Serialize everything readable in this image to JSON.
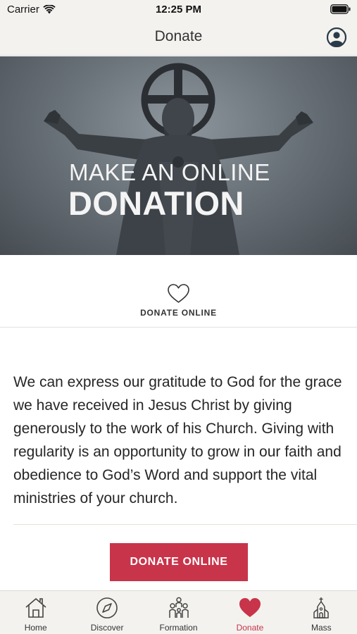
{
  "status_bar": {
    "carrier": "Carrier",
    "time": "12:25 PM"
  },
  "nav": {
    "title": "Donate",
    "profile_icon": "profile-icon"
  },
  "hero": {
    "line1": "MAKE AN ONLINE",
    "line2": "DONATION"
  },
  "tile": {
    "icon": "heart-outline-icon",
    "label": "DONATE ONLINE"
  },
  "body": {
    "paragraph": "We can express our gratitude to God for the grace we have received in Jesus Christ by giving generously to the work of his Church. Giving with regularity is an opportunity to grow in our faith and obedience to God’s Word and support the vital ministries of your church."
  },
  "cta": {
    "label": "DONATE ONLINE"
  },
  "tabs": [
    {
      "label": "Home",
      "icon": "home-icon",
      "active": false
    },
    {
      "label": "Discover",
      "icon": "compass-icon",
      "active": false
    },
    {
      "label": "Formation",
      "icon": "people-icon",
      "active": false
    },
    {
      "label": "Donate",
      "icon": "heart-icon",
      "active": true
    },
    {
      "label": "Mass",
      "icon": "church-icon",
      "active": false
    }
  ],
  "colors": {
    "accent": "#c8344a",
    "bar_background": "#f3f2ef"
  }
}
